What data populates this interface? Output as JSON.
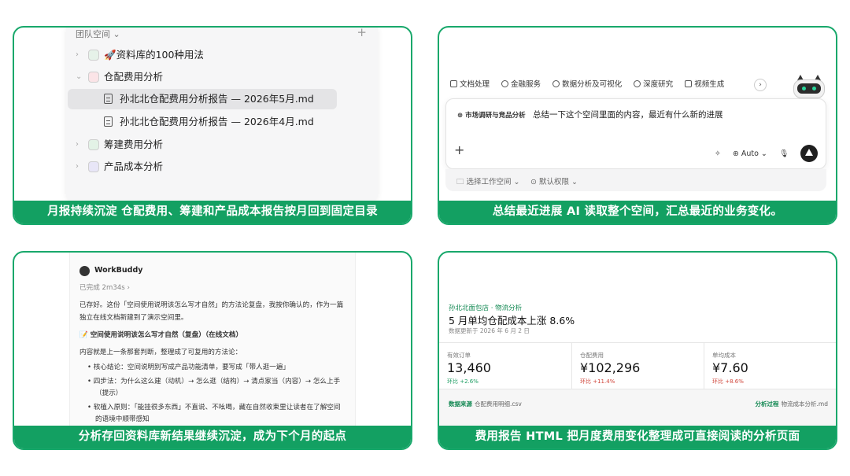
{
  "panel1": {
    "caption": "月报持续沉淀 仓配费用、筹建和产品成本报告按月回到固定目录",
    "tree_header": "团队空间 ⌄",
    "tree_add": "+",
    "items": [
      {
        "label": "🚀资料库的100种用法",
        "color": "#e6f2e9"
      },
      {
        "label": "仓配费用分析",
        "color": "#fbe4e7"
      },
      {
        "label": "孙北北仓配费用分析报告 — 2026年5月.md"
      },
      {
        "label": "孙北北仓配费用分析报告 — 2026年4月.md"
      },
      {
        "label": "筹建费用分析",
        "color": "#e3f2e6"
      },
      {
        "label": "产品成本分析",
        "color": "#e8e6f7"
      }
    ]
  },
  "panel2": {
    "caption": "总结最近进展 AI 读取整个空间，汇总最近的业务变化。",
    "chips": [
      "文档处理",
      "金融服务",
      "数据分析及可视化",
      "深度研究",
      "视频生成"
    ],
    "more": "›",
    "tag": "⊗ 市场调研与竞品分析",
    "query": "总结一下这个空间里面的内容，最近有什么新的进展",
    "add": "+",
    "model": "⊛ Auto ⌄",
    "footer_workspace": "🗀 选择工作空间 ⌄",
    "footer_permission": "⊙ 默认权限 ⌄"
  },
  "panel3": {
    "caption": "分析存回资料库新结果继续沉淀，成为下个月的起点",
    "assistant": "WorkBuddy",
    "status": "已完成 2m34s ›",
    "lines": [
      "已存好。这份「空间使用说明该怎么写才自然」的方法论复盘，我按你确认的，作为一篇",
      "独立在线文档新建到了演示空间里。",
      "📝 空间使用说明该怎么写才自然（复盘）（在线文档）",
      "内容就是上一条那套判断，整理成了可复用的方法论：",
      "• 核心结论：空间说明别写成产品功能清单，要写成「带人逛一遍」",
      "• 四步法：为什么这么建（动机）→ 怎么逛（结构）→ 清点家当（内容）→ 怎么上手",
      "（提示）",
      "• 软植入原则：「能挂很多东西」不直说、不吆喝，藏在自然收束里让读者在了解空间",
      "的语境中顺带感知"
    ]
  },
  "panel4": {
    "caption": "费用报告 HTML 把月度费用变化整理成可直接阅读的分析页面",
    "subtitle": "孙北北面包店 · 物流分析",
    "title": "5 月单均仓配成本上涨 8.6%",
    "updated": "数据更新于 2026 年 6 月 2 日",
    "metrics": [
      {
        "label": "有效订单",
        "value": "13,460",
        "delta": "环比 +2.6%"
      },
      {
        "label": "仓配费用",
        "value": "¥102,296",
        "delta": "环比 +11.4%"
      },
      {
        "label": "单均成本",
        "value": "¥7.60",
        "delta": "环比 +8.6%"
      }
    ],
    "source_label": "数据来源",
    "source_value": "仓配费用明细.csv",
    "process_label": "分析过程",
    "process_value": "物流成本分析.md"
  }
}
